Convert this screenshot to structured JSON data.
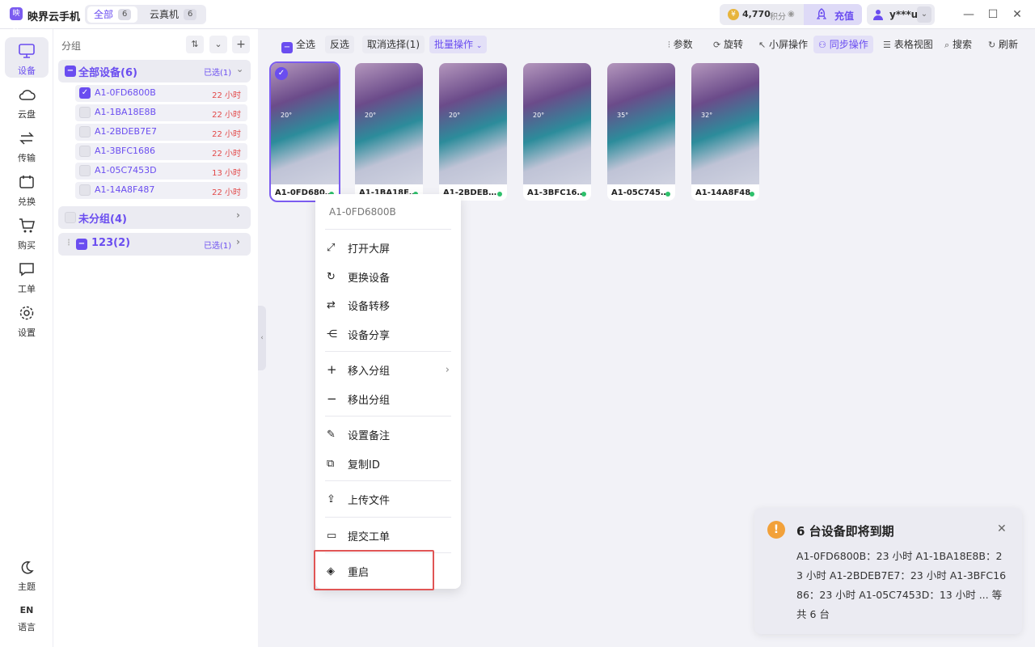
{
  "app": {
    "name": "映界云手机",
    "logo_text": "映界"
  },
  "tabs": [
    {
      "label": "全部",
      "count": "6"
    },
    {
      "label": "云真机",
      "count": "6"
    }
  ],
  "points": {
    "value": "4,770",
    "unit": "积分"
  },
  "charge_label": "充值",
  "user": {
    "name": "y***u"
  },
  "nav": [
    {
      "label": "设备",
      "icon": "monitor-icon"
    },
    {
      "label": "云盘",
      "icon": "cloud-icon"
    },
    {
      "label": "传输",
      "icon": "transfer-icon"
    },
    {
      "label": "兑换",
      "icon": "ticket-icon"
    },
    {
      "label": "购买",
      "icon": "cart-icon"
    },
    {
      "label": "工单",
      "icon": "chat-icon"
    },
    {
      "label": "设置",
      "icon": "gear-icon"
    }
  ],
  "nav_bottom": {
    "theme": "主题",
    "lang_code": "EN",
    "lang": "语言"
  },
  "groups": {
    "header": "分组",
    "all": {
      "label": "全部设备(6)",
      "selected": "已选(1)"
    },
    "devices": [
      {
        "id": "A1-0FD6800B",
        "hours": "22 小时",
        "checked": true
      },
      {
        "id": "A1-1BA18E8B",
        "hours": "22 小时",
        "checked": false
      },
      {
        "id": "A1-2BDEB7E7",
        "hours": "22 小时",
        "checked": false
      },
      {
        "id": "A1-3BFC1686",
        "hours": "22 小时",
        "checked": false
      },
      {
        "id": "A1-05C7453D",
        "hours": "13 小时",
        "checked": false
      },
      {
        "id": "A1-14A8F487",
        "hours": "22 小时",
        "checked": false
      }
    ],
    "ungrouped": "未分组(4)",
    "g123": {
      "label": "123(2)",
      "selected": "已选(1)"
    }
  },
  "toolbar": {
    "select_all": "全选",
    "invert": "反选",
    "cancel": "取消选择(1)",
    "batch": "批量操作",
    "params": "参数",
    "rotate": "旋转",
    "small_ops": "小屏操作",
    "sync": "同步操作",
    "table_view": "表格视图",
    "search": "搜索",
    "refresh": "刷新"
  },
  "cards": [
    {
      "name": "A1-0FD680…",
      "temp": "20°"
    },
    {
      "name": "A1-1BA18E…",
      "temp": "20°"
    },
    {
      "name": "A1-2BDEB…",
      "temp": "20°"
    },
    {
      "name": "A1-3BFC16…",
      "temp": "20°"
    },
    {
      "name": "A1-05C745…",
      "temp": "35°"
    },
    {
      "name": "A1-14A8F487",
      "temp": "32°"
    }
  ],
  "menu": {
    "title": "A1-0FD6800B",
    "open": "打开大屏",
    "replace": "更换设备",
    "transfer": "设备转移",
    "share": "设备分享",
    "move_in": "移入分组",
    "move_out": "移出分组",
    "note": "设置备注",
    "copy_id": "复制ID",
    "upload": "上传文件",
    "ticket": "提交工单",
    "restart": "重启"
  },
  "toast": {
    "title": "6 台设备即将到期",
    "body": "A1-0FD6800B：23 小时 A1-1BA18E8B：23 小时 A1-2BDEB7E7：23 小时 A1-3BFC1686：23 小时 A1-05C7453D：13 小时 ... 等共 6 台"
  },
  "colors": {
    "accent": "#6a4df0",
    "danger": "#e24848",
    "highlight": "#e05555",
    "online": "#2ec06b"
  }
}
